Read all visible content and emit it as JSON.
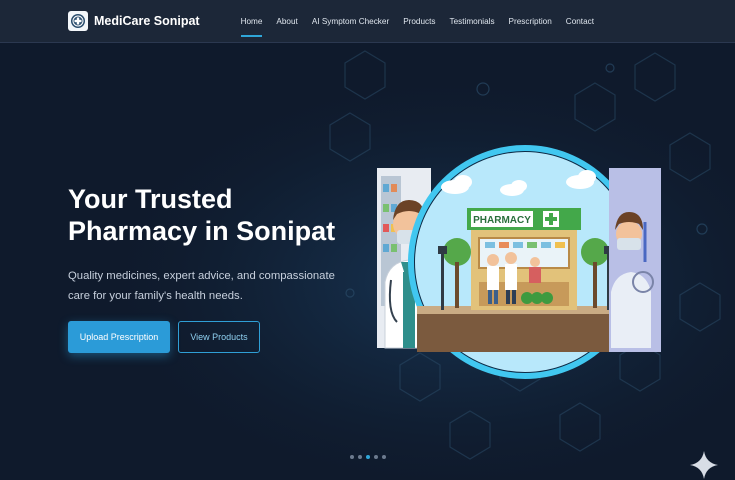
{
  "brand": {
    "name": "MediCare Sonipat",
    "logo_icon": "medical-cross-icon"
  },
  "nav": {
    "items": [
      {
        "label": "Home",
        "active": true
      },
      {
        "label": "About"
      },
      {
        "label": "AI Symptom Checker"
      },
      {
        "label": "Products"
      },
      {
        "label": "Testimonials"
      },
      {
        "label": "Prescription"
      },
      {
        "label": "Contact"
      }
    ]
  },
  "hero": {
    "title": "Your Trusted Pharmacy in Sonipat",
    "subtitle": "Quality medicines, expert advice, and compassionate care for your family's health needs.",
    "primary_button": "Upload Prescription",
    "secondary_button": "View Products"
  },
  "illustration": {
    "shop_sign": "PHARMACY"
  },
  "carousel": {
    "slides": 5,
    "active_index": 2
  },
  "colors": {
    "background": "#0f1a2c",
    "navbar": "#1c2738",
    "accent": "#2b9bd8",
    "ring": "#41c7f0",
    "sign_green": "#43a84a"
  }
}
